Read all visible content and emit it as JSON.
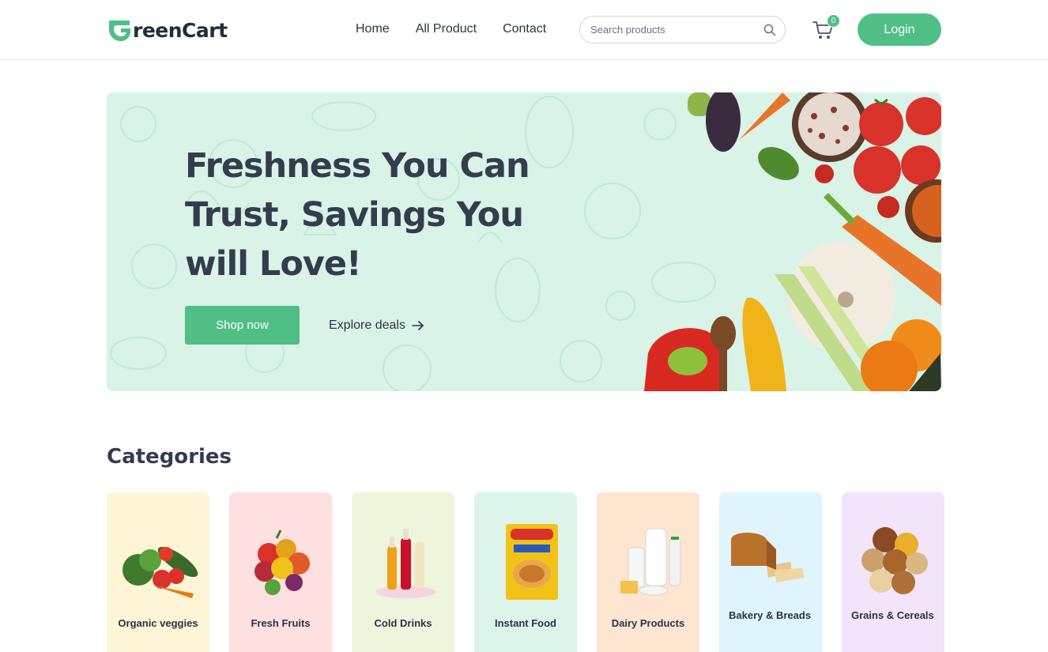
{
  "header": {
    "logo_text": "reenCart",
    "nav": [
      "Home",
      "All Product",
      "Contact"
    ],
    "search_placeholder": "Search products",
    "cart_count": "0",
    "login_label": "Login"
  },
  "hero": {
    "title": "Freshness You Can Trust, Savings You will Love!",
    "shop_label": "Shop now",
    "explore_label": "Explore deals",
    "background_color": "#d9f3e6"
  },
  "categories": {
    "title": "Categories",
    "items": [
      {
        "label": "Organic veggies",
        "bg": "#fef5d7"
      },
      {
        "label": "Fresh Fruits",
        "bg": "#fee0e0"
      },
      {
        "label": "Cold Drinks",
        "bg": "#eef5dd"
      },
      {
        "label": "Instant Food",
        "bg": "#ddf4ea"
      },
      {
        "label": "Dairy Products",
        "bg": "#fee5d0"
      },
      {
        "label": "Bakery & Breads",
        "bg": "#e0f4fd"
      },
      {
        "label": "Grains & Cereals",
        "bg": "#f1e4fb"
      }
    ]
  },
  "colors": {
    "accent": "#4fbf86",
    "text_dark": "#333d4e"
  }
}
